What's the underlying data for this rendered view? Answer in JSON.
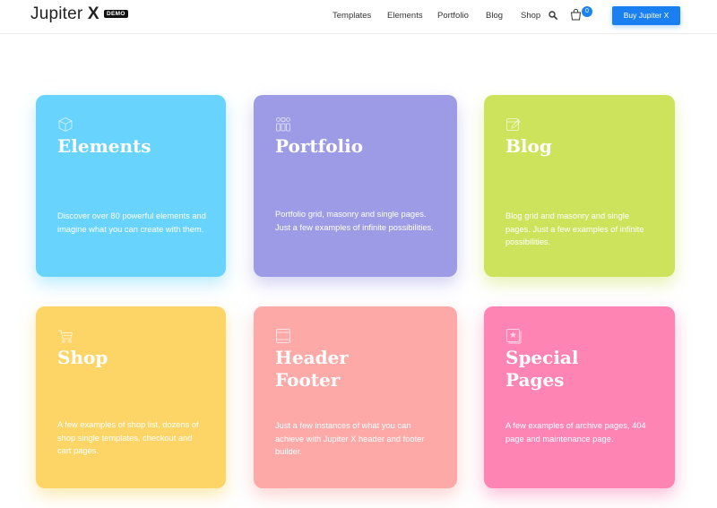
{
  "header": {
    "logo_text": "Jupiter",
    "logo_x": "X",
    "badge": "DEMO",
    "nav": [
      "Templates",
      "Elements",
      "Portfolio",
      "Blog",
      "Shop"
    ],
    "search_icon": "search-icon",
    "cart_icon": "cart-icon",
    "cart_count": "0",
    "buy_button": "Buy Jupiter X",
    "accent_color": "#1a7ff0"
  },
  "cards": [
    {
      "title": "Elements",
      "icon": "cube-icon",
      "color": "#68d3fc",
      "description": "Discover over 80 powerful elements and imagine what you can create with them."
    },
    {
      "title": "Portfolio",
      "icon": "grid-icon",
      "color": "#9d9be5",
      "description": "Portfolio grid, masonry and single pages. Just a few examples of infinite possibilities."
    },
    {
      "title": "Blog",
      "icon": "edit-icon",
      "color": "#cde35c",
      "description": "Blog grid and masonry and single pages. Just a few examples of infinite possibilities."
    },
    {
      "title": "Shop",
      "icon": "cart-icon",
      "color": "#fdd566",
      "description": "A few examples of shop list, dozens of shop single templates, checkout and cart pages."
    },
    {
      "title": "Header\nFooter",
      "icon": "layout-icon",
      "color": "#fda9a8",
      "description": "Just a few instances of what you can achieve with Jupiter X header and footer builder."
    },
    {
      "title": "Special\nPages",
      "icon": "star-page-icon",
      "color": "#fe84b4",
      "description": "A few examples of archive pages, 404 page and maintenance page."
    }
  ]
}
